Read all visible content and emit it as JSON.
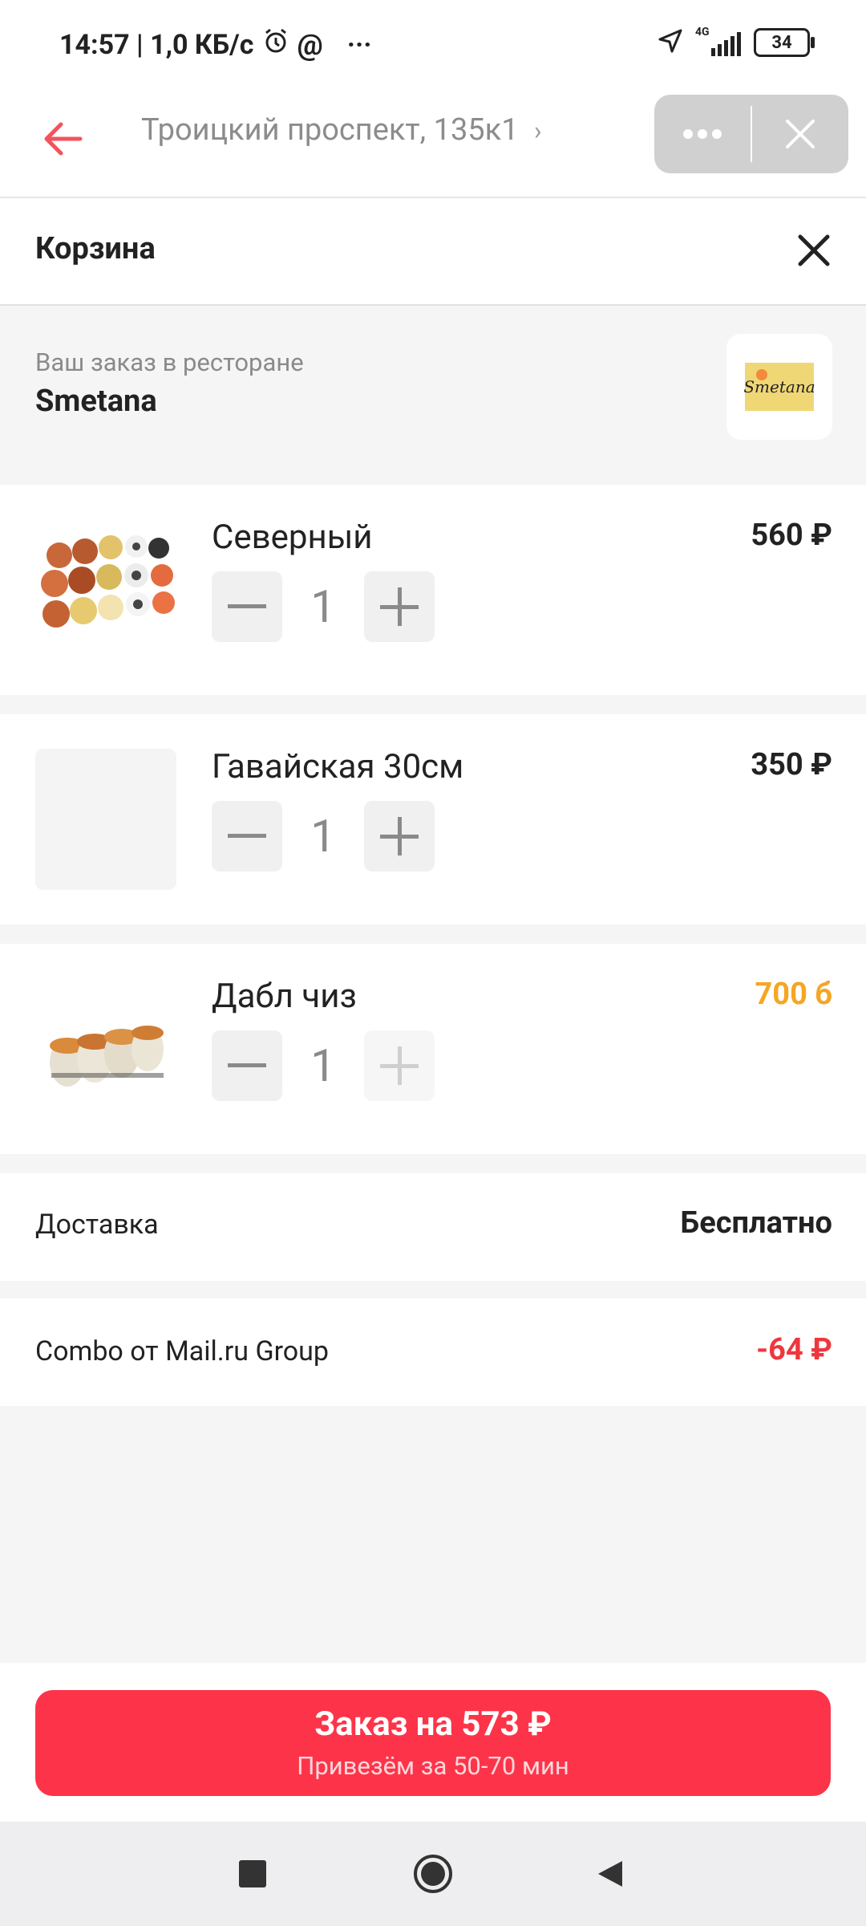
{
  "status_bar": {
    "time_speed": "14:57 | 1,0 КБ/с",
    "network_label": "4G",
    "battery": "34"
  },
  "topnav": {
    "address": "Троицкий проспект, 135к1"
  },
  "cart": {
    "title": "Корзина"
  },
  "restaurant": {
    "subtitle": "Ваш заказ в ресторане",
    "name": "Smetana",
    "logo_text": "Smetana"
  },
  "items": [
    {
      "name": "Северный",
      "qty": "1",
      "price": "560 ₽",
      "price_color": "#222222",
      "image": "sushi-set"
    },
    {
      "name": "Гавайская 30см",
      "qty": "1",
      "price": "350 ₽",
      "price_color": "#222222",
      "image": "placeholder"
    },
    {
      "name": "Дабл чиз",
      "qty": "1",
      "price": "700 б",
      "price_color": "#f5a623",
      "image": "rolls"
    }
  ],
  "delivery": {
    "label": "Доставка",
    "value": "Бесплатно"
  },
  "discount": {
    "label": "Combo от Mail.ru Group",
    "value": "-64 ₽",
    "color": "#f0363d"
  },
  "order_button": {
    "main": "Заказ на 573 ₽",
    "sub": "Привезём за 50-70 мин",
    "color": "#fd3449"
  },
  "colors": {
    "accent": "#f0363d",
    "back_arrow": "#f2545b"
  }
}
